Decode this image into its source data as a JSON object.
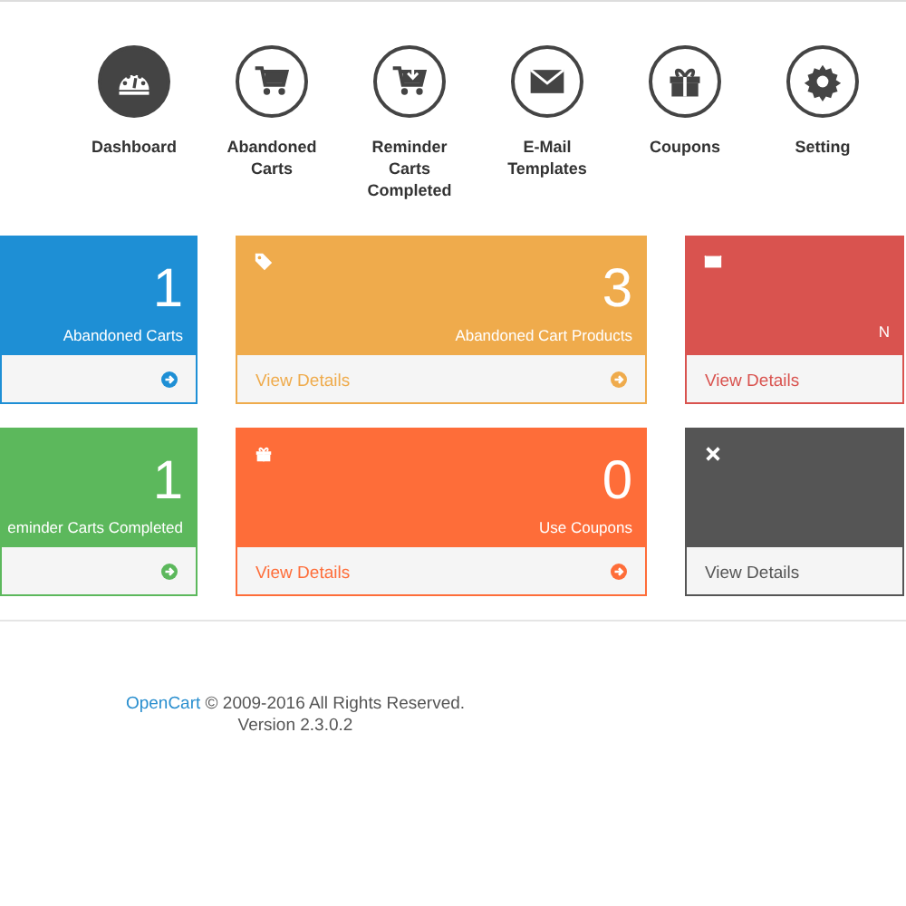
{
  "nav": [
    {
      "label": "Dashboard",
      "selected": true
    },
    {
      "label": "Abandoned Carts",
      "selected": false
    },
    {
      "label": "Reminder Carts Completed",
      "selected": false
    },
    {
      "label": "E-Mail Templates",
      "selected": false
    },
    {
      "label": "Coupons",
      "selected": false
    },
    {
      "label": "Setting",
      "selected": false
    }
  ],
  "card_rows": [
    [
      {
        "color": "#1e8fd5",
        "number": "1",
        "label": "Abandoned Carts",
        "arrow": true
      },
      {
        "color": "#efab4c",
        "number": "3",
        "label": "Abandoned Cart Products",
        "link": "View Details",
        "arrow": true
      },
      {
        "color": "#d9534f",
        "label": "N",
        "link": "View Details",
        "arrow": false
      }
    ],
    [
      {
        "color": "#5cb85c",
        "number": "1",
        "label": "eminder Carts Completed",
        "arrow": true
      },
      {
        "color": "#fe6d39",
        "number": "0",
        "label": "Use Coupons",
        "link": "View Details",
        "arrow": true
      },
      {
        "color": "#555555",
        "link": "View Details",
        "arrow": false
      }
    ]
  ],
  "footer": {
    "brand": "OpenCart",
    "text": "© 2009-2016 All Rights Reserved.",
    "version": "Version 2.3.0.2"
  }
}
